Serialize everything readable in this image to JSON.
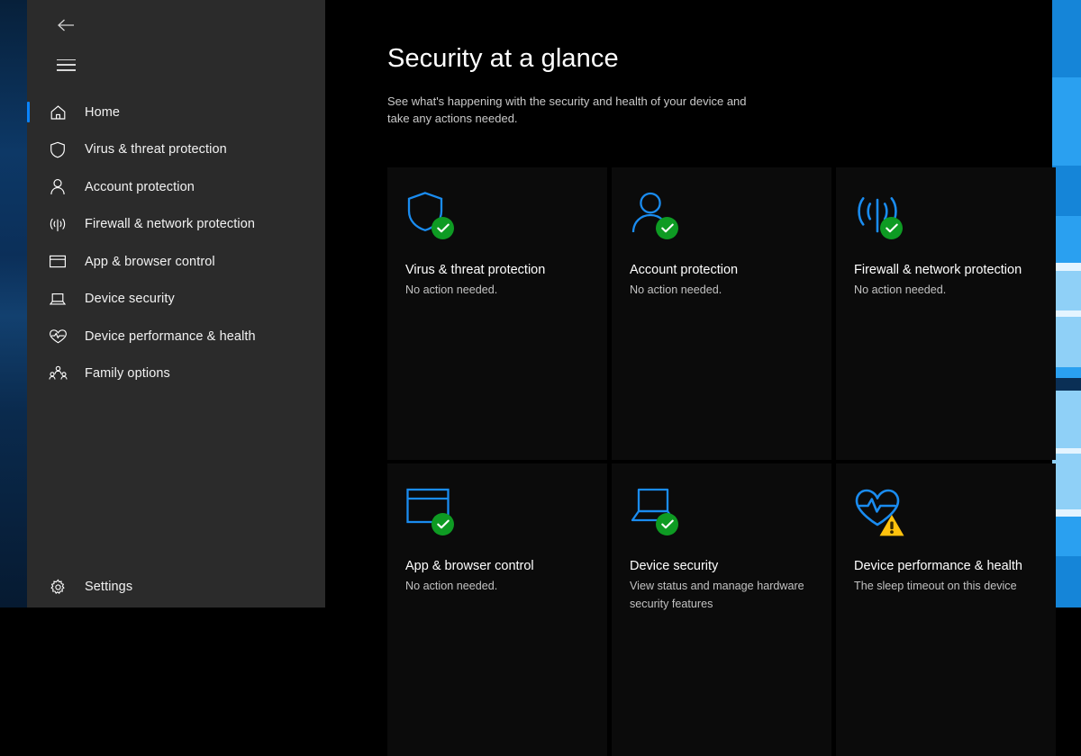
{
  "window": {
    "back_label": "Back",
    "menu_label": "Navigation menu"
  },
  "sidebar": {
    "items": [
      {
        "label": "Home",
        "icon": "home-icon",
        "active": true
      },
      {
        "label": "Virus & threat protection",
        "icon": "shield-icon",
        "active": false
      },
      {
        "label": "Account protection",
        "icon": "person-icon",
        "active": false
      },
      {
        "label": "Firewall & network protection",
        "icon": "broadcast-icon",
        "active": false
      },
      {
        "label": "App & browser control",
        "icon": "window-icon",
        "active": false
      },
      {
        "label": "Device security",
        "icon": "laptop-icon",
        "active": false
      },
      {
        "label": "Device performance & health",
        "icon": "heart-icon",
        "active": false
      },
      {
        "label": "Family options",
        "icon": "family-icon",
        "active": false
      }
    ],
    "settings": {
      "label": "Settings",
      "icon": "gear-icon"
    }
  },
  "main": {
    "title": "Security at a glance",
    "subtitle": "See what's happening with the security and health of your device and take any actions needed.",
    "cards": [
      {
        "title": "Virus & threat protection",
        "status": "No action needed.",
        "icon": "shield-icon",
        "badge": "check"
      },
      {
        "title": "Account protection",
        "status": "No action needed.",
        "icon": "person-icon",
        "badge": "check"
      },
      {
        "title": "Firewall & network protection",
        "status": "No action needed.",
        "icon": "broadcast-icon",
        "badge": "check"
      },
      {
        "title": "App & browser control",
        "status": "No action needed.",
        "icon": "window-icon",
        "badge": "check"
      },
      {
        "title": "Device security",
        "status": "View status and manage hardware security features",
        "icon": "laptop-icon",
        "badge": "check"
      },
      {
        "title": "Device performance & health",
        "status": "The sleep timeout on this device",
        "icon": "heart-icon",
        "badge": "warning"
      }
    ]
  },
  "colors": {
    "accent_blue": "#0a84ff",
    "icon_blue": "#1a8cf0",
    "ok_green": "#0e9b23",
    "warn_yellow": "#ffc20e",
    "sidebar_bg": "#2b2b2b",
    "card_bg": "#0b0b0b",
    "page_bg": "#000000"
  }
}
